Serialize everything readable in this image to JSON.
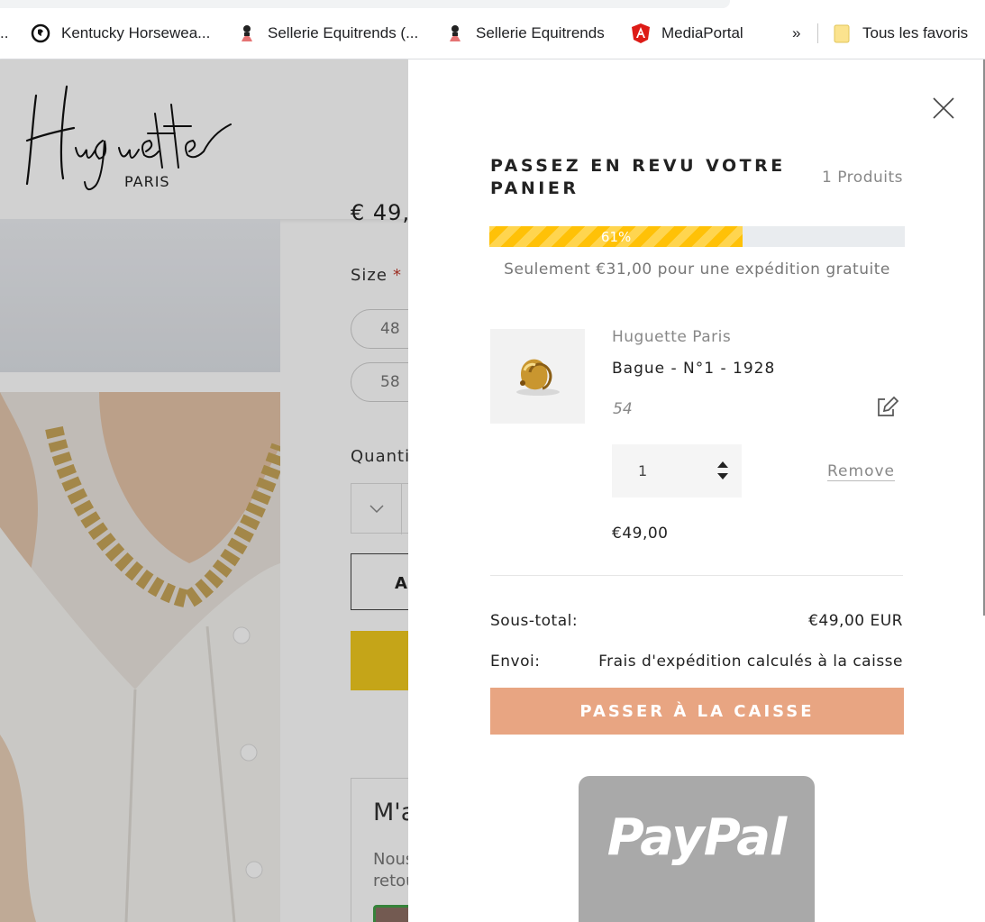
{
  "bookmarks": {
    "items": [
      {
        "label": "Kentucky Horsewea...",
        "icon": "kentucky-logo-icon"
      },
      {
        "label": "Sellerie Equitrends (...",
        "icon": "sellerie-icon"
      },
      {
        "label": "Sellerie Equitrends",
        "icon": "sellerie-icon"
      },
      {
        "label": "MediaPortal",
        "icon": "angular-icon"
      }
    ],
    "leading": "..",
    "overflow": "»",
    "all_favorites": "Tous les favoris"
  },
  "page": {
    "logo_text": "Huguette",
    "logo_sub": "PARIS",
    "price_partial": "€ 49,",
    "size_label": "Size",
    "size_required": "*",
    "sizes": [
      "48",
      "58"
    ],
    "quantity_label": "Quanti",
    "add_button": "A",
    "card_title": "M'a",
    "card_text": "Nous retou"
  },
  "cart": {
    "title": "PASSEZ EN REVU VOTRE PANIER",
    "count": "1 Produits",
    "progress_label": "61%",
    "progress_value": 0.61,
    "shipping_message": "Seulement €31,00 pour une expédition gratuite",
    "item": {
      "vendor": "Huguette Paris",
      "name": "Bague - N°1 - 1928",
      "variant": "54",
      "quantity": "1",
      "remove": "Remove",
      "price": "€49,00"
    },
    "subtotal_label": "Sous-total:",
    "subtotal_value": "€49,00 EUR",
    "shipping_label": "Envoi:",
    "shipping_value": "Frais d'expédition calculés à la caisse",
    "checkout_button": "PASSER À LA CAISSE",
    "paypal_label": "PayPal"
  },
  "colors": {
    "progress": "#ffc107",
    "checkout": "#e8a582",
    "paypal_bg": "#a9a9a9",
    "buy_button": "#f1ca1e"
  }
}
